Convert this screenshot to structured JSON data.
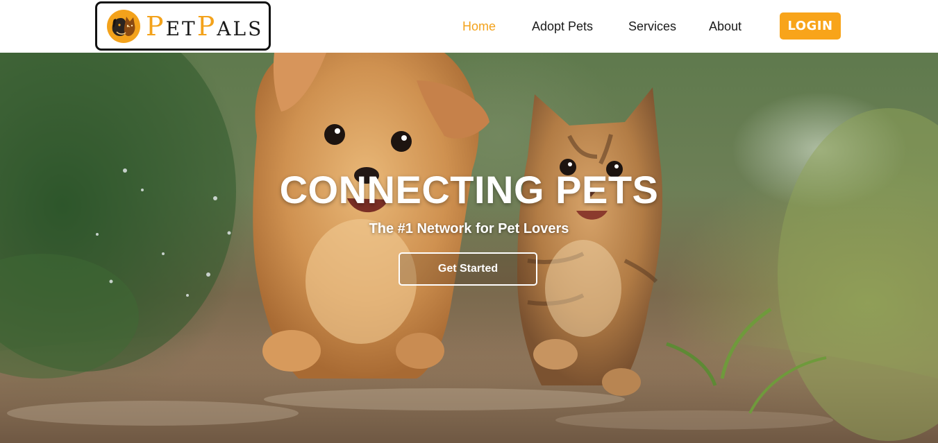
{
  "brand": {
    "logo_cap1": "P",
    "logo_rest1": "ET",
    "logo_cap2": "P",
    "logo_rest2": "ALS",
    "primary_color": "#f8a41a",
    "logo_icon": "dog-and-cat-emblem-icon"
  },
  "nav": {
    "items": [
      {
        "label": "Home",
        "active": true
      },
      {
        "label": "Adopt Pets",
        "active": false
      },
      {
        "label": "Services",
        "active": false
      },
      {
        "label": "About",
        "active": false
      }
    ],
    "login_label": "LOGIN"
  },
  "hero": {
    "title": "CONNECTING PETS",
    "subtitle": "The #1 Network for Pet Lovers",
    "cta_label": "Get Started",
    "image": "puppy-and-kitten-running-photo"
  }
}
